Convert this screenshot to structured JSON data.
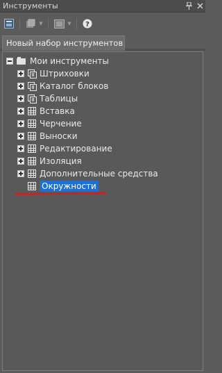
{
  "window": {
    "title": "Инструменты",
    "pin_icon": "pin-icon",
    "close_icon": "close-icon"
  },
  "toolbar": {
    "icons": [
      "tool-palette-icon",
      "properties-icon",
      "view-options-icon",
      "help-icon"
    ]
  },
  "tab": {
    "label": "Новый набор инструментов"
  },
  "tree": {
    "root": {
      "label": "Мои инструменты",
      "icon": "folder-icon"
    },
    "items": [
      {
        "label": "Штриховки",
        "icon": "stack-icon"
      },
      {
        "label": "Каталог блоков",
        "icon": "stack-icon"
      },
      {
        "label": "Таблицы",
        "icon": "stack-icon"
      },
      {
        "label": "Вставка",
        "icon": "grid-icon"
      },
      {
        "label": "Черчение",
        "icon": "grid-icon"
      },
      {
        "label": "Выноски",
        "icon": "grid-icon"
      },
      {
        "label": "Редактирование",
        "icon": "grid-icon"
      },
      {
        "label": "Изоляция",
        "icon": "grid-icon"
      },
      {
        "label": "Дополнительные средства",
        "icon": "grid-icon"
      }
    ],
    "selected": {
      "label": "Окружности",
      "icon": "grid-icon"
    }
  },
  "colors": {
    "selection": "#1f6fd0",
    "annotation_underline": "#d21e1e"
  }
}
